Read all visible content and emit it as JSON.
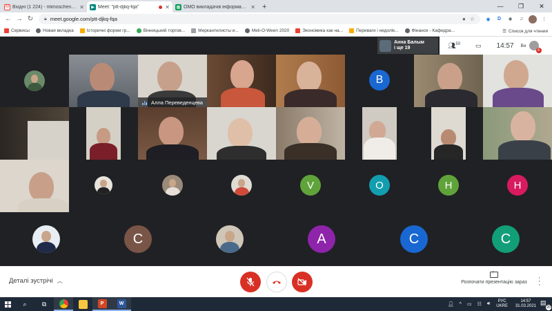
{
  "browser": {
    "tabs": [
      {
        "title": "Вхідні (1 224) - ntimoschenkom@",
        "favicon": "gmail-icon",
        "active": false
      },
      {
        "title": "Meet: \"ptt-djkq-fqa\"",
        "favicon": "meet-icon",
        "active": true,
        "recording": true
      },
      {
        "title": "ОМО викладачів інформатики",
        "favicon": "sheets-icon",
        "active": false
      }
    ],
    "new_tab": "+",
    "url": "meet.google.com/ptt-djkq-fqa",
    "bookmarks": [
      {
        "label": "Сервисы",
        "icon": "apps-icon",
        "color": "#ea4335"
      },
      {
        "label": "Новая вкладка",
        "icon": "globe-icon",
        "color": "#5f6368"
      },
      {
        "label": "Історичні форми гр...",
        "icon": "folder-icon",
        "color": "#f9ab00"
      },
      {
        "label": "Вінницький торгов...",
        "icon": "leaf-icon",
        "color": "#34a853"
      },
      {
        "label": "Меркантилисты и...",
        "icon": "page-icon",
        "color": "#9aa0a6"
      },
      {
        "label": "Meli-O-Ween 2020",
        "icon": "globe-icon",
        "color": "#5f6368"
      },
      {
        "label": "Экономика как на...",
        "icon": "page-icon",
        "color": "#ea4335"
      },
      {
        "label": "Переваги і недолік...",
        "icon": "folder-icon",
        "color": "#f9ab00"
      },
      {
        "label": "Фінанси - Кафедра...",
        "icon": "globe-icon",
        "color": "#5f6368"
      }
    ],
    "reading_list": "Список для чтения"
  },
  "meet": {
    "presenter": {
      "line1": "Анна Балым",
      "line2": "і ще 19"
    },
    "people_count": "50",
    "clock": "14:57",
    "you_label": "Ви",
    "you_badge": "8",
    "active_speaker": "Алла Переведенцева",
    "avatars": {
      "b": {
        "letter": "B",
        "color": "#1967d2"
      },
      "v": {
        "letter": "V",
        "color": "#5fa33a"
      },
      "o": {
        "letter": "O",
        "color": "#129eaf"
      },
      "h1": {
        "letter": "H",
        "color": "#5fa33a"
      },
      "h2": {
        "letter": "H",
        "color": "#d81b60"
      },
      "c1": {
        "letter": "C",
        "color": "#795548"
      },
      "a": {
        "letter": "A",
        "color": "#8e24aa"
      },
      "c2": {
        "letter": "C",
        "color": "#1967d2"
      },
      "c3": {
        "letter": "C",
        "color": "#129e78"
      }
    },
    "details_label": "Деталі зустрічі",
    "present_label": "Розпочати презентацію зараз"
  },
  "taskbar": {
    "lang_line1": "РУС",
    "lang_line2": "UKRE",
    "time": "14:57",
    "date": "31.03.2021",
    "notifications": "20"
  }
}
